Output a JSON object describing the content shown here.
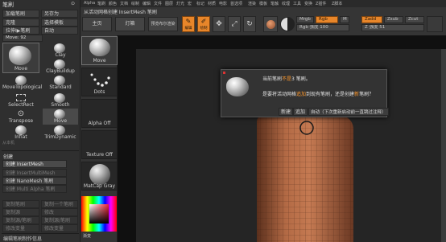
{
  "left_panel": {
    "title": "笔刷",
    "row1": [
      "加载笔刷",
      "另存为"
    ],
    "row2": [
      "克隆",
      "选择模板"
    ],
    "row3": [
      "拉伸Ⅰ▶笔刷",
      "自动"
    ],
    "move_field": "Move: 92",
    "brushes": [
      "Move",
      "Clay",
      "ClayBuildup",
      "Standard",
      "SelectRect",
      "Smooth",
      "Transpose",
      "Inflat",
      "TrimDynamic",
      "Move",
      "MoveTopological",
      "从本机"
    ],
    "create_section": "创建",
    "create_buttons": [
      "创建 InsertMesh",
      "创建 InsertMultiMesh",
      "创建 NanoMesh 笔刷",
      "创建 Multi Alpha 笔刷"
    ],
    "lower_rows": [
      [
        "复制笔刷",
        "复制一个笔刷"
      ],
      [
        "复制源",
        "修改"
      ],
      [
        "复制源/笔刷",
        "复制源/笔刷"
      ],
      [
        "修改变量",
        "修改变量"
      ]
    ],
    "footer": "编辑笔刷制作信息"
  },
  "menubar": [
    "Alpha",
    "笔刷",
    "颜色",
    "文档",
    "绘制",
    "编辑",
    "文件",
    "图层",
    "灯光",
    "宏",
    "标记",
    "材质",
    "电影",
    "首选项",
    "渲染",
    "模板",
    "笔触",
    "纹理",
    "工具",
    "变换",
    "Z插件",
    "Z脚本"
  ],
  "toolbar": {
    "hint": "从活动网格创建 InsertMesh 笔刷",
    "home_button": "主页",
    "light_button": "灯箱",
    "preview_button": "预览布尔渲染",
    "edit_label": "编辑",
    "draw_label": "绘制",
    "mrgb": "Mrgb",
    "rgb": "Rgb",
    "m": "M",
    "zadd": "Zadd",
    "zsub": "Zsub",
    "zcut": "Zcut",
    "rgb_intensity": "Rgb 强度 100",
    "z_intensity": "Z 强度 51"
  },
  "shelf": [
    "Move",
    "Dots",
    "Alpha Off",
    "Texture Off",
    "MatCap Gray"
  ],
  "shelf_bottom": "渐变",
  "dialog": {
    "line1_pre": "当前笔刷",
    "line1_hi": "不是",
    "line1_post": "3 笔刷。",
    "line2_pre": "是要将活动网格",
    "line2_hi1": "追加",
    "line2_mid": "到现有笔刷，还是创建",
    "line2_hi2": "新",
    "line2_post": "笔刷？",
    "buttons": [
      "新建",
      "追加",
      "自动（下次重新启动前一直跳过注释）"
    ]
  },
  "colors": {
    "accent": "#e8862a",
    "mesh": "#b36a45",
    "palette_bg": "#2f2f2f"
  }
}
